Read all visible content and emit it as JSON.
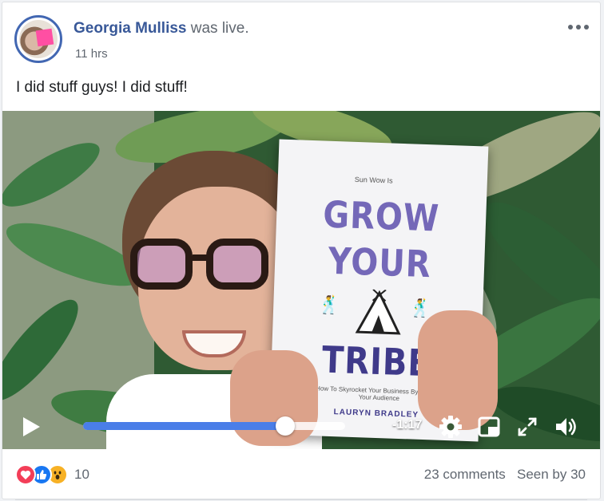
{
  "post": {
    "author_name": "Georgia Mulliss",
    "author_action": "was live.",
    "timestamp": "11 hrs",
    "text": "I did stuff guys! I did stuff!"
  },
  "video": {
    "book": {
      "kicker": "Sun Wow Is",
      "title_line1": "GROW",
      "title_line2": "YOUR",
      "title_line3": "TRIBE",
      "subtitle": "How To Skyrocket Your Business By Leading Your Audience",
      "author": "LAURYN BRADLEY"
    },
    "controls": {
      "progress_fraction": 0.77,
      "time_remaining": "-1:17"
    }
  },
  "engagement": {
    "reactions": [
      "love",
      "like",
      "wow"
    ],
    "reaction_count": "10",
    "comments": "23 comments",
    "seen_by": "Seen by 30"
  },
  "colors": {
    "link_blue": "#385898",
    "progress_blue": "#4a7ee8",
    "love": "#f33e58",
    "like": "#1877f2",
    "wow": "#f7b125"
  }
}
